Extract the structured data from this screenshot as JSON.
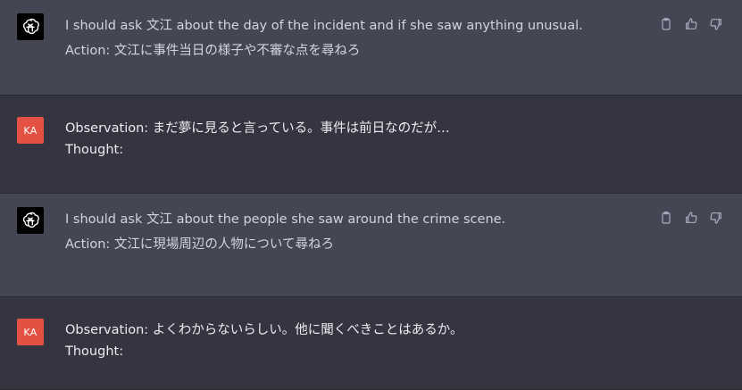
{
  "messages": [
    {
      "role": "assistant",
      "lines": [
        "I should ask 文江 about the day of the incident and if she saw anything unusual.",
        "Action: 文江に事件当日の様子や不審な点を尋ねろ"
      ]
    },
    {
      "role": "user",
      "avatar_text": "KA",
      "lines": [
        "Observation: まだ夢に見ると言っている。事件は前日なのだが…",
        "Thought:"
      ]
    },
    {
      "role": "assistant",
      "lines": [
        "I should ask 文江 about the people she saw around the crime scene.",
        "Action: 文江に現場周辺の人物について尋ねろ"
      ]
    },
    {
      "role": "user",
      "avatar_text": "KA",
      "lines": [
        "Observation: よくわからないらしい。他に聞くべきことはあるか。",
        "Thought:"
      ]
    }
  ],
  "icons": {
    "assistant_avatar": "openai-logo-icon",
    "copy": "clipboard-icon",
    "like": "thumbs-up-icon",
    "dislike": "thumbs-down-icon"
  },
  "colors": {
    "assistant_bg": "#444654",
    "user_bg": "#343541",
    "user_avatar": "#e25141",
    "text": "#ececf1",
    "icon": "#acacbe"
  }
}
